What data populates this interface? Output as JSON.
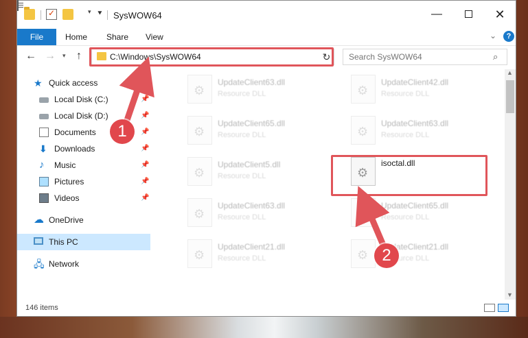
{
  "window": {
    "title": "SysWOW64",
    "minimize_glyph": "—",
    "close_glyph": "✕"
  },
  "ribbon": {
    "tabs": [
      "File",
      "Home",
      "Share",
      "View"
    ]
  },
  "address": {
    "path": "C:\\Windows\\SysWOW64",
    "search_placeholder": "Search SysWOW64"
  },
  "nav": {
    "quick_access": "Quick access",
    "items": [
      {
        "label": "Local Disk (C:)",
        "icon": "hard-drive-icon"
      },
      {
        "label": "Local Disk (D:)",
        "icon": "hard-drive-icon"
      },
      {
        "label": "Documents",
        "icon": "documents-icon"
      },
      {
        "label": "Downloads",
        "icon": "downloads-icon"
      },
      {
        "label": "Music",
        "icon": "music-icon"
      },
      {
        "label": "Pictures",
        "icon": "pictures-icon"
      },
      {
        "label": "Videos",
        "icon": "videos-icon"
      }
    ],
    "onedrive": "OneDrive",
    "this_pc": "This PC",
    "network": "Network"
  },
  "files": [
    {
      "name": "UpdateClient63.dll",
      "desc": "Resource DLL"
    },
    {
      "name": "UpdateClient42.dll",
      "desc": "Resource DLL"
    },
    {
      "name": "UpdateClient65.dll",
      "desc": "Resource DLL"
    },
    {
      "name": "UpdateClient63.dll",
      "desc": "Resource DLL"
    },
    {
      "name": "UpdateClient5.dll",
      "desc": "Resource DLL"
    },
    {
      "name": "isoctal.dll",
      "desc": ""
    },
    {
      "name": "UpdateClient63.dll",
      "desc": "Resource DLL"
    },
    {
      "name": "UpdateClient65.dll",
      "desc": "Resource DLL"
    },
    {
      "name": "UpdateClient21.dll",
      "desc": "Resource DLL"
    },
    {
      "name": "UpdateClient21.dll",
      "desc": "Resource DLL"
    }
  ],
  "status": {
    "item_count": "146 items"
  },
  "annotations": {
    "step1": "1",
    "step2": "2",
    "color": "#e0555a"
  }
}
